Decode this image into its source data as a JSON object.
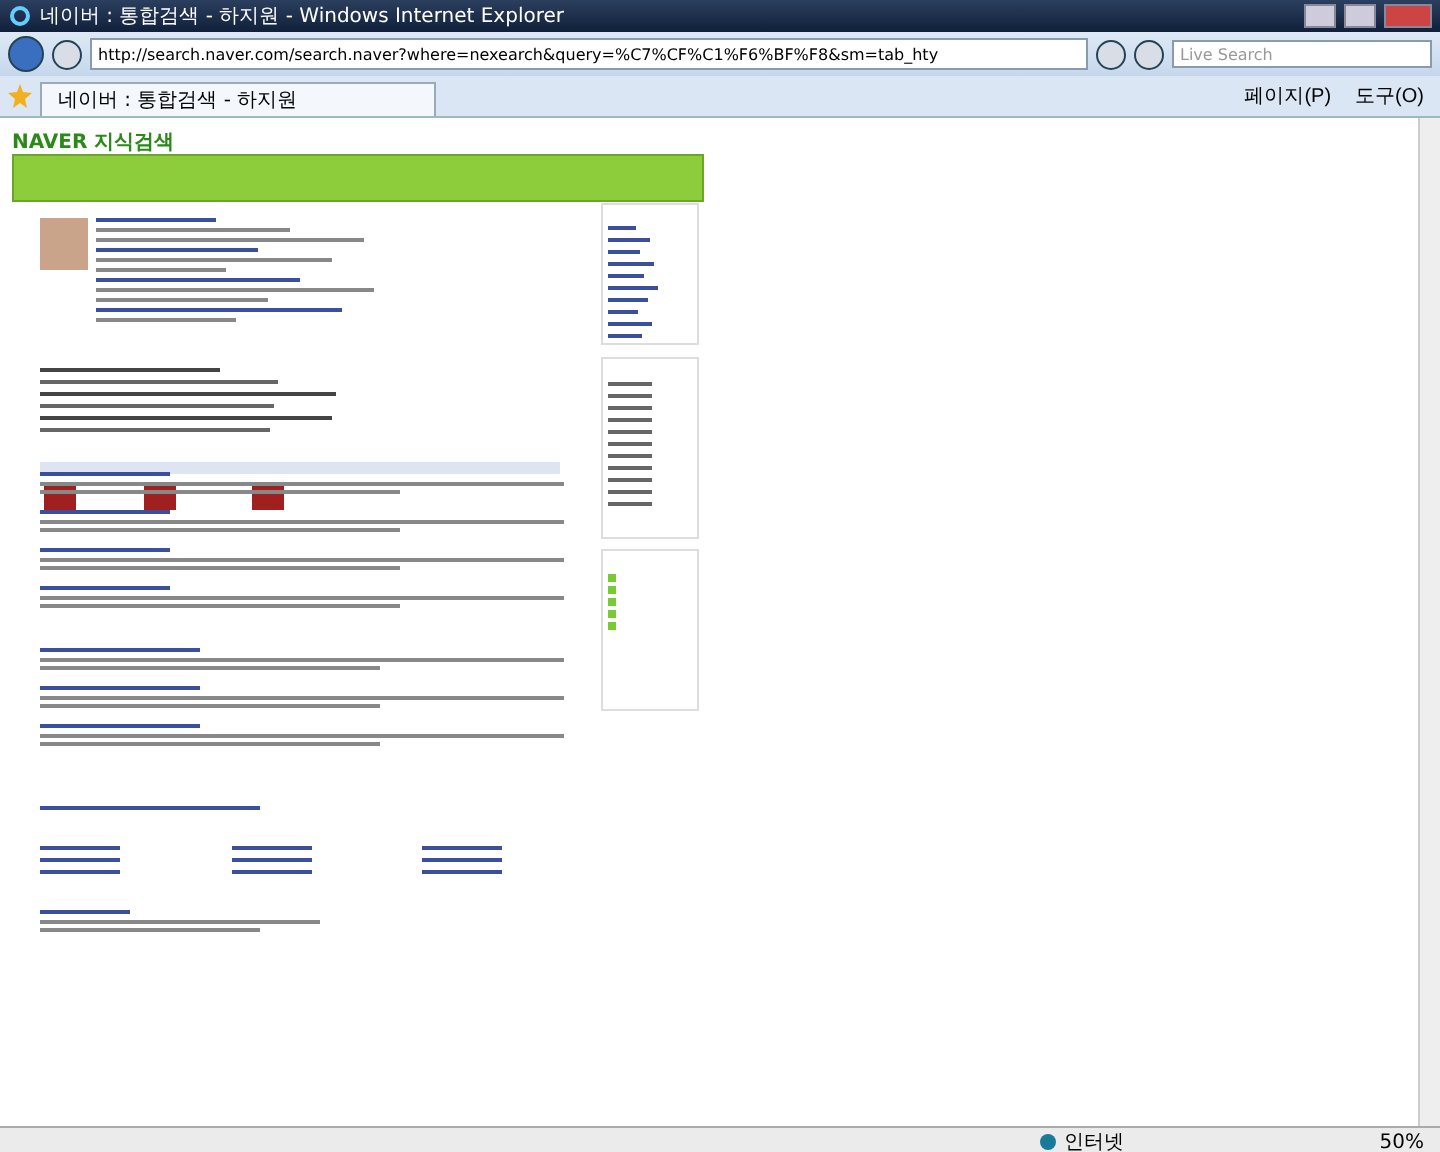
{
  "window": {
    "title": "네이버 : 통합검색 - 하지원 - Windows Internet Explorer"
  },
  "address_bar": {
    "url": "http://search.naver.com/search.naver?where=nexearch&query=%C7%CF%C1%F6%BF%F8&sm=tab_hty"
  },
  "search": {
    "placeholder": "Live Search"
  },
  "tabs": [
    {
      "label": "네이버 : 통합검색 - 하지원",
      "selected": true
    }
  ],
  "command_bar": [
    "페이지(P)",
    "도구(O)"
  ],
  "page": {
    "logo": "NAVER 지식검색"
  },
  "status_bar": {
    "zone": "인터넷",
    "zoom": "50%"
  }
}
